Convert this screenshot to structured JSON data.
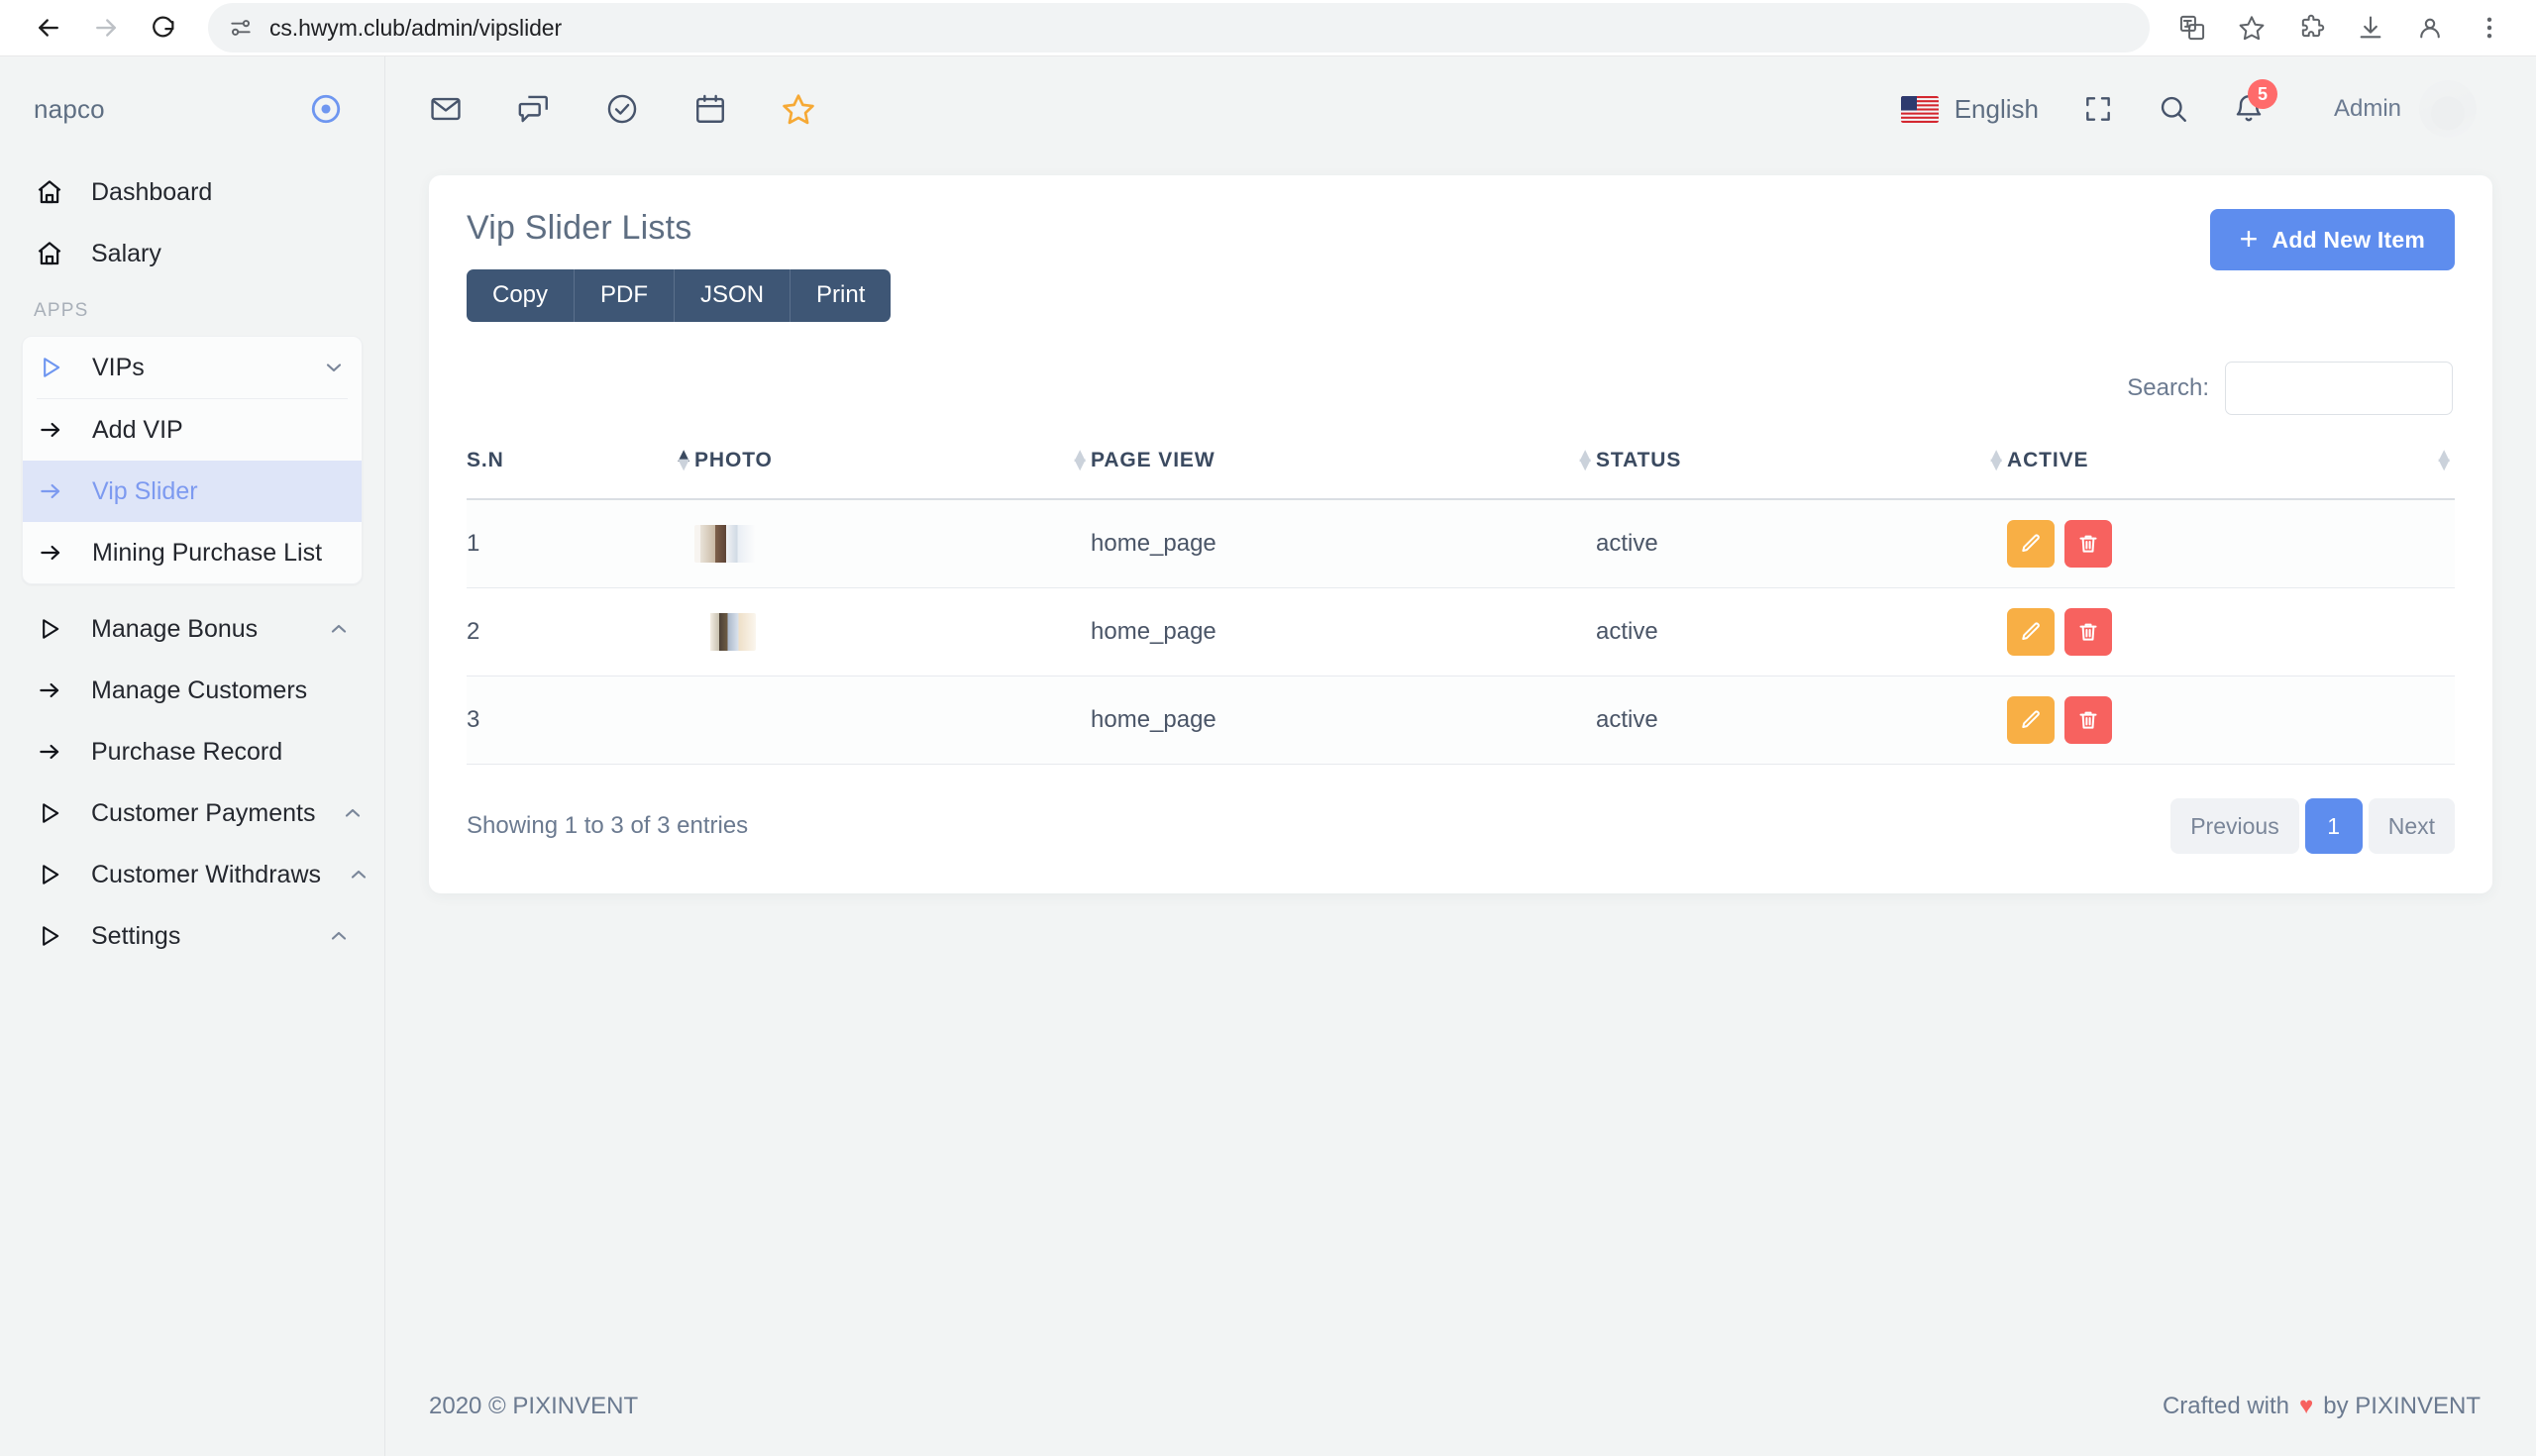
{
  "browser": {
    "url": "cs.hwym.club/admin/vipslider",
    "back_icon": "back-arrow-icon",
    "forward_icon": "forward-arrow-icon",
    "reload_icon": "reload-icon",
    "site_settings_icon": "site-settings-icon",
    "translate_icon": "translate-icon",
    "bookmark_icon": "star-icon",
    "extensions_icon": "extensions-icon",
    "downloads_icon": "download-icon",
    "profile_icon": "profile-icon",
    "menu_icon": "kebab-menu-icon"
  },
  "sidebar": {
    "brand": "napco",
    "brand_logo_icon": "circle-dot-logo-icon",
    "top_items": [
      {
        "label": "Dashboard",
        "icon": "home-icon"
      },
      {
        "label": "Salary",
        "icon": "home-icon"
      }
    ],
    "section_label": "APPS",
    "group": {
      "label": "VIPs",
      "icon": "play-triangle-icon",
      "chevron": "chevron-down-icon",
      "children": [
        {
          "label": "Add VIP",
          "icon": "arrow-right-icon",
          "active": false
        },
        {
          "label": "Vip Slider",
          "icon": "arrow-right-icon",
          "active": true
        },
        {
          "label": "Mining Purchase List",
          "icon": "arrow-right-icon",
          "active": false
        }
      ]
    },
    "rest_items": [
      {
        "label": "Manage Bonus",
        "icon": "play-triangle-icon",
        "chevron": "chevron-up-icon"
      },
      {
        "label": "Manage Customers",
        "icon": "arrow-right-icon",
        "chevron": ""
      },
      {
        "label": "Purchase Record",
        "icon": "arrow-right-icon",
        "chevron": ""
      },
      {
        "label": "Customer Payments",
        "icon": "play-triangle-icon",
        "chevron": "chevron-up-icon"
      },
      {
        "label": "Customer Withdraws",
        "icon": "play-triangle-icon",
        "chevron": "chevron-up-icon"
      },
      {
        "label": "Settings",
        "icon": "play-triangle-icon",
        "chevron": "chevron-up-icon"
      }
    ]
  },
  "topbar": {
    "left_icons": [
      "mail-icon",
      "chat-icon",
      "check-circle-icon",
      "calendar-icon",
      "star-icon"
    ],
    "language": "English",
    "flag_icon": "us-flag-icon",
    "fullscreen_icon": "fullscreen-icon",
    "search_icon": "search-icon",
    "bell_icon": "bell-icon",
    "notification_count": "5",
    "user_name": "Admin",
    "avatar_icon": "user-avatar"
  },
  "card": {
    "title": "Vip Slider Lists",
    "add_button": {
      "label": "Add New Item",
      "plus": "+",
      "color": "#5E8DEE"
    },
    "export_buttons": [
      "Copy",
      "PDF",
      "JSON",
      "Print"
    ],
    "search": {
      "label": "Search:",
      "value": "",
      "placeholder": ""
    }
  },
  "table": {
    "columns": [
      {
        "label": "S.N",
        "sort": "asc"
      },
      {
        "label": "PHOTO",
        "sort": "none"
      },
      {
        "label": "PAGE VIEW",
        "sort": "none"
      },
      {
        "label": "STATUS",
        "sort": "none"
      },
      {
        "label": "ACTIVE",
        "sort": "none"
      }
    ],
    "rows": [
      {
        "sn": "1",
        "photo": "banner-thumbnail-a",
        "page_view": "home_page",
        "status": "active"
      },
      {
        "sn": "2",
        "photo": "banner-thumbnail-b",
        "page_view": "home_page",
        "status": "active"
      },
      {
        "sn": "3",
        "photo": "",
        "page_view": "home_page",
        "status": "active"
      }
    ],
    "actions": {
      "edit_icon": "pencil-icon",
      "delete_icon": "trash-icon",
      "edit_color": "#F8AF45",
      "delete_color": "#F7625F"
    },
    "entries_info": "Showing 1 to 3 of 3 entries",
    "pagination": {
      "previous": "Previous",
      "pages": [
        "1"
      ],
      "next": "Next",
      "current": "1"
    }
  },
  "footer": {
    "left": "2020 © PIXINVENT",
    "crafted_prefix": "Crafted with",
    "heart": "♥",
    "crafted_suffix": "by PIXINVENT"
  }
}
